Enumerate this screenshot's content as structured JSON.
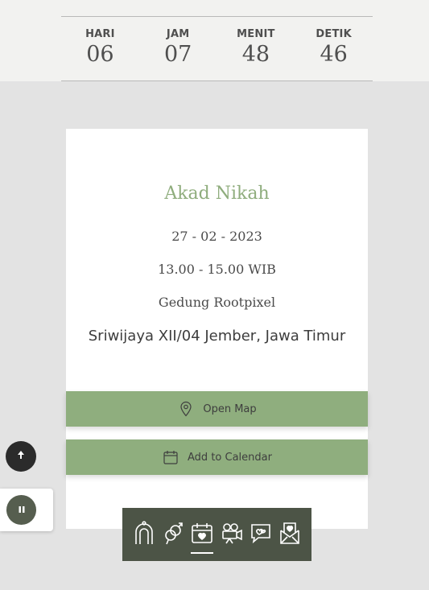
{
  "countdown": {
    "units": [
      {
        "label": "HARI",
        "value": "06"
      },
      {
        "label": "JAM",
        "value": "07"
      },
      {
        "label": "MENIT",
        "value": "48"
      },
      {
        "label": "DETIK",
        "value": "46"
      }
    ]
  },
  "event": {
    "title": "Akad Nikah",
    "date": "27 - 02 - 2023",
    "time": "13.00 - 15.00 WIB",
    "venue": "Gedung Rootpixel",
    "address": "Sriwijaya XII/04 Jember, Jawa Timur"
  },
  "buttons": {
    "open_map": "Open Map",
    "add_calendar": "Add to Calendar"
  },
  "icons": {
    "scroll_top": "arrow-up-icon",
    "music": "pause-icon",
    "map": "map-pin-icon",
    "calendar": "calendar-icon"
  },
  "nav": {
    "items": [
      {
        "icon": "arch-icon"
      },
      {
        "icon": "couple-icon"
      },
      {
        "icon": "calendar-icon",
        "active": true
      },
      {
        "icon": "video-camera-icon"
      },
      {
        "icon": "message-heart-icon"
      },
      {
        "icon": "envelope-heart-icon"
      }
    ]
  },
  "colors": {
    "accent_green": "#8fae7e",
    "nav_bg": "#4c5446",
    "title_green": "#8fad7d",
    "dark_text": "#4a4a4a"
  }
}
